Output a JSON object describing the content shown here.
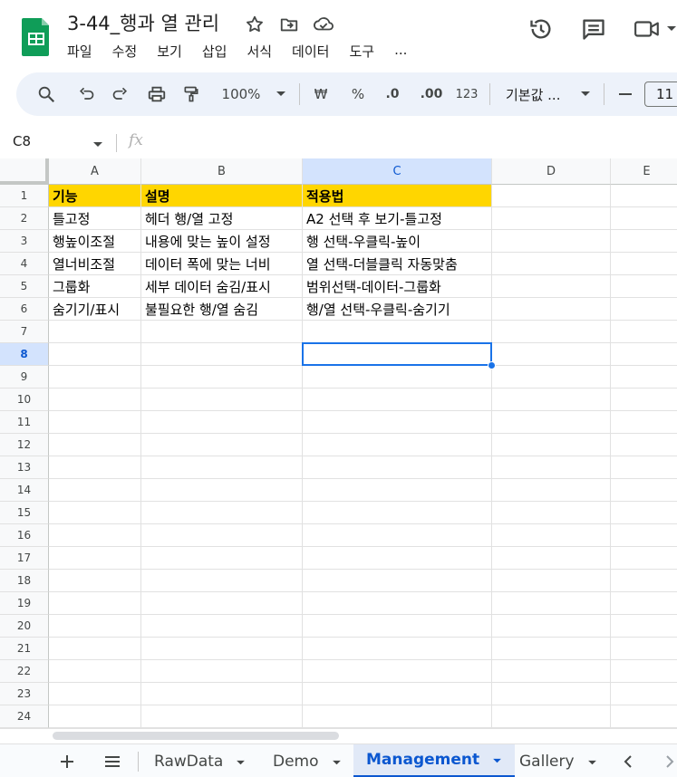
{
  "document": {
    "title": "3-44_행과 열 관리",
    "menu": [
      "파일",
      "수정",
      "보기",
      "삽입",
      "서식",
      "데이터",
      "도구",
      "..."
    ]
  },
  "toolbar": {
    "zoom": "100%",
    "currency": "₩",
    "percent": "%",
    "decrease_decimal": ".0",
    "increase_decimal": ".00",
    "number_format": "123",
    "font": "기본값 ...",
    "font_size": "11"
  },
  "formula_bar": {
    "name_box": "C8",
    "fx": "fx"
  },
  "grid": {
    "columns": [
      "A",
      "B",
      "C",
      "D",
      "E"
    ],
    "rows": [
      "1",
      "2",
      "3",
      "4",
      "5",
      "6",
      "7",
      "8",
      "9",
      "10",
      "11",
      "12",
      "13",
      "14",
      "15",
      "16",
      "17",
      "18",
      "19",
      "20",
      "21",
      "22",
      "23",
      "24"
    ],
    "active_cell": "C8",
    "header_fill": "#ffd600",
    "cells": [
      [
        "기능",
        "설명",
        "적용법"
      ],
      [
        "틀고정",
        "헤더 행/열 고정",
        "A2 선택 후 보기-틀고정"
      ],
      [
        "행높이조절",
        "내용에 맞는 높이 설정",
        "행 선택-우클릭-높이"
      ],
      [
        "열너비조절",
        "데이터 폭에 맞는 너비",
        "열 선택-더블클릭 자동맞춤"
      ],
      [
        "그룹화",
        "세부 데이터 숨김/표시",
        "범위선택-데이터-그룹화"
      ],
      [
        "숨기기/표시",
        "불필요한 행/열 숨김",
        "행/열 선택-우클릭-숨기기"
      ]
    ]
  },
  "sheets": {
    "tabs": [
      "RawData",
      "Demo",
      "Management",
      "Gallery"
    ],
    "active": "Management"
  },
  "colors": {
    "accent": "#0b57d0",
    "selection": "#1a73e8",
    "logo": "#0f9d58"
  }
}
